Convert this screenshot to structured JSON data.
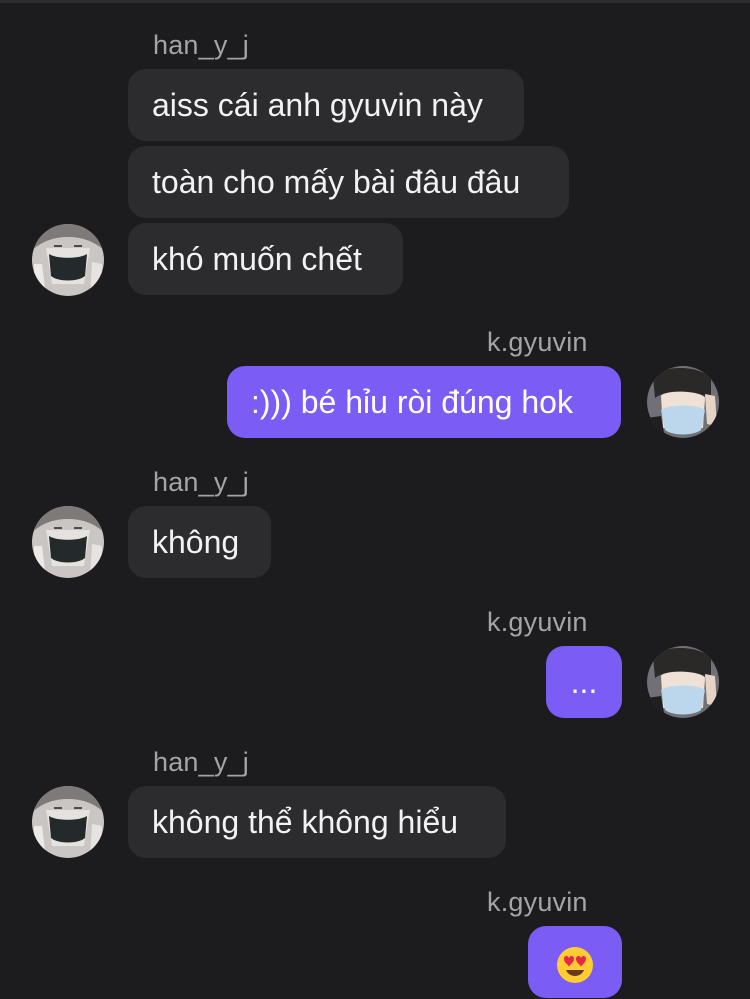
{
  "conversation": {
    "messages": [
      {
        "sender": "han_y_j",
        "text": "aiss cái anh gyuvin này"
      },
      {
        "sender": "han_y_j",
        "text": "toàn cho mấy bài đâu đâu"
      },
      {
        "sender": "han_y_j",
        "text": "khó muốn chết"
      },
      {
        "sender": "k.gyuvin",
        "text": ":))) bé hỉu ròi đúng hok"
      },
      {
        "sender": "han_y_j",
        "text": "không"
      },
      {
        "sender": "k.gyuvin",
        "text": "..."
      },
      {
        "sender": "han_y_j",
        "text": "không thể không hiểu"
      },
      {
        "sender": "k.gyuvin",
        "text": "😍"
      }
    ]
  },
  "icons": {
    "incoming_avatar": "avatar-black-mask",
    "outgoing_avatar": "avatar-blue-mask",
    "heart_eyes": "smiling-face-with-heart-eyes-emoji"
  },
  "colors": {
    "background": "#1c1c1e",
    "incoming_bubble": "#2c2c2f",
    "outgoing_bubble": "#7b5cf5",
    "username": "#a4a4a8"
  }
}
